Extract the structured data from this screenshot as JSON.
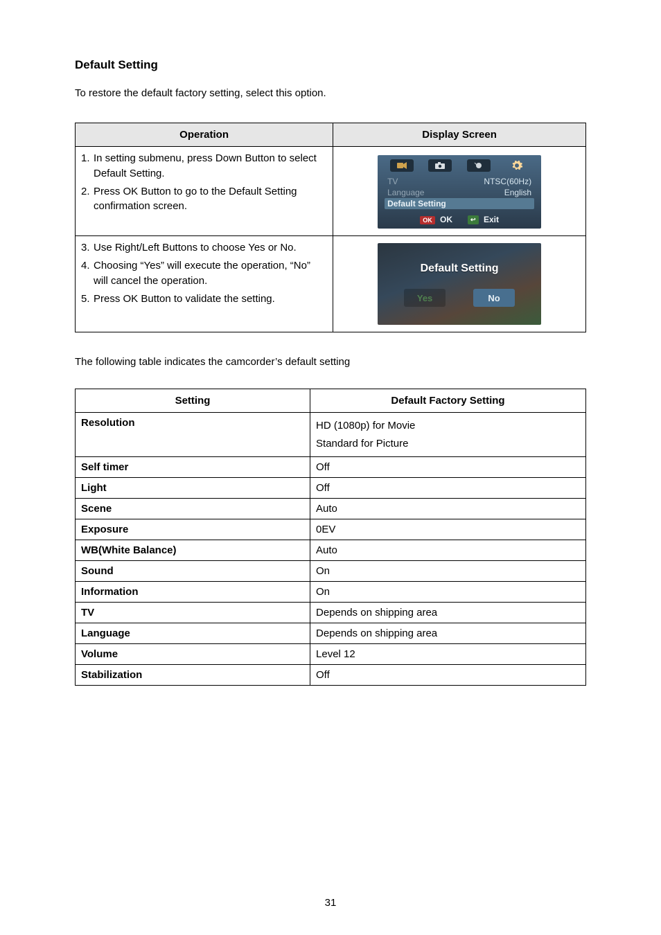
{
  "title": "Default Setting",
  "intro": "To restore the default factory setting, select this option.",
  "opTable": {
    "headers": {
      "op": "Operation",
      "screen": "Display Screen"
    },
    "row1": {
      "steps": [
        {
          "num": "1.",
          "text": "In setting submenu, press Down Button to select Default Setting."
        },
        {
          "num": "2.",
          "text": "Press OK Button to go to the Default Setting confirmation screen."
        }
      ]
    },
    "row2": {
      "steps": [
        {
          "num": "3.",
          "text": "Use Right/Left Buttons to choose Yes or No."
        },
        {
          "num": "4.",
          "text": "Choosing “Yes” will execute the operation, “No” will cancel the operation."
        },
        {
          "num": "5.",
          "text": "Press OK Button to validate the setting."
        }
      ]
    }
  },
  "screen1": {
    "rows": [
      {
        "label": "TV",
        "value": "NTSC(60Hz)"
      },
      {
        "label": "Language",
        "value": "English"
      },
      {
        "label": "Default Setting",
        "value": ""
      }
    ],
    "ok_pill": "OK",
    "ok_label": "OK",
    "exit_glyph": "↩",
    "exit_label": "Exit"
  },
  "screen2": {
    "header": "Default Setting",
    "yes": "Yes",
    "no": "No"
  },
  "midText": "The following table indicates the camcorder’s default setting",
  "defTable": {
    "headers": {
      "setting": "Setting",
      "value": "Default Factory Setting"
    },
    "rows": [
      {
        "label": "Resolution",
        "value": "HD (1080p) for Movie\nStandard for Picture"
      },
      {
        "label": "Self timer",
        "value": "Off"
      },
      {
        "label": "Light",
        "value": "Off"
      },
      {
        "label": "Scene",
        "value": "Auto"
      },
      {
        "label": "Exposure",
        "value": "0EV"
      },
      {
        "label": "WB(White Balance)",
        "value": "Auto"
      },
      {
        "label": "Sound",
        "value": "On"
      },
      {
        "label": "Information",
        "value": "On"
      },
      {
        "label": "TV",
        "value": "Depends on shipping area"
      },
      {
        "label": "Language",
        "value": "Depends on shipping area"
      },
      {
        "label": "Volume",
        "value": "Level 12"
      },
      {
        "label": "Stabilization",
        "value": "Off"
      }
    ]
  },
  "pageNumber": "31"
}
